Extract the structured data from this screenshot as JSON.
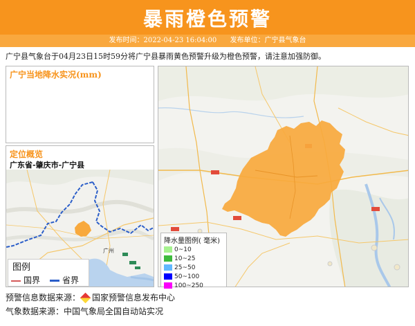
{
  "header": {
    "title": "暴雨橙色预警",
    "publish_time_label": "发布时间：2022-04-23 16:04:00",
    "publisher_label": "发布单位：广宁县气象台"
  },
  "notice": "广宁县气象台于04月23日15时59分将广宁县暴雨黄色预警升级为橙色预警，请注意加强防御。",
  "rain_panel": {
    "title": "广宁当地降水实况(mm)"
  },
  "location_panel": {
    "title": "定位概览",
    "path": "广东省-肇庆市-广宁县",
    "map_label": "广州",
    "legend": {
      "title": "图例",
      "items": [
        {
          "label": "国界",
          "color": "#d45a5a"
        },
        {
          "label": "省界",
          "color": "#2b5ec9"
        }
      ]
    }
  },
  "rain_legend": {
    "title": "降水量图例( 毫米)",
    "items": [
      {
        "label": "0~10",
        "color": "#a6f28f"
      },
      {
        "label": "10~25",
        "color": "#3dba3d"
      },
      {
        "label": "25~50",
        "color": "#61b8ff"
      },
      {
        "label": "50~100",
        "color": "#0000fe"
      },
      {
        "label": "100~250",
        "color": "#fa00fa"
      }
    ]
  },
  "colors": {
    "accent": "#f7941d",
    "county_fill": "#f8a93d"
  },
  "footer": {
    "warning_source_label": "预警信息数据来源：",
    "warning_source": "国家预警信息发布中心",
    "weather_source": "气象数据来源：中国气象局全国自动站实况"
  }
}
